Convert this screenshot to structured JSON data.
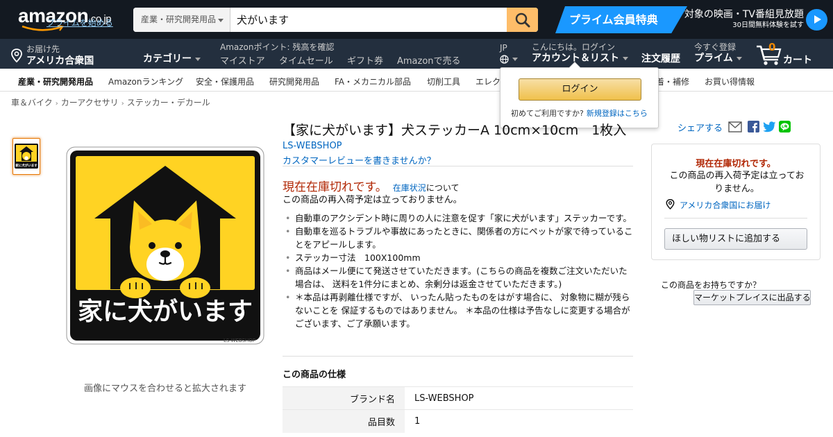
{
  "header": {
    "logo": {
      "word": "amazon",
      "suffix": ".co.jp",
      "prime_link": "プライムを始める"
    },
    "search": {
      "category": "産業・研究開発用品",
      "query": "犬がいます"
    },
    "prime_banner": {
      "badge": "プライム会員特典",
      "line1": "対象の映画・TV番組見放題",
      "line2": "30日間無料体験を試す"
    }
  },
  "nav": {
    "deliver_label": "お届け先",
    "deliver_place": "アメリカ合衆国",
    "category": "カテゴリー",
    "points": "Amazonポイント: 残高を確認",
    "links": [
      "マイストア",
      "タイムセール",
      "ギフト券",
      "Amazonで売る"
    ],
    "lang": "JP",
    "account_greeting": "こんにちは。ログイン",
    "account_label": "アカウント＆リスト",
    "orders": "注文履歴",
    "prime_small": "今すぐ登録",
    "prime_label": "プライム",
    "cart_count": "0",
    "cart_label": "カート"
  },
  "subnav": [
    "産業・研究開発用品",
    "Amazonランキング",
    "安全・保護用品",
    "研究開発用品",
    "FA・メカニカル部品",
    "切削工具",
    "エレク",
    "着・補修",
    "お買い得情報"
  ],
  "flyout": {
    "login": "ログイン",
    "first_time": "初めてご利用ですか?",
    "register": "新規登録はこちら"
  },
  "breadcrumb": [
    "車＆バイク",
    "カーアクセサリ",
    "ステッカー・デカール"
  ],
  "product": {
    "image_text": "家に犬がいます",
    "image_credit": "LS-WEBSHOP",
    "thumb_text": "家に犬がいます",
    "image_caption": "画像にマウスを合わせると拡大されます",
    "title": "【家に犬がいます】犬ステッカーA 10cm×10cm　1枚入",
    "brand": "LS-WEBSHOP",
    "review_link": "カスタマーレビューを書きませんか？",
    "out_of_stock": "現在在庫切れです。",
    "stock_link": "在庫状況",
    "stock_suffix": "について",
    "restock": "この商品の再入荷予定は立っておりません。",
    "bullets": [
      "自動車のアクシデント時に周りの人に注意を促す「家に犬がいます」ステッカーです。",
      "自動車を巡るトラブルや事故にあったときに、関係者の方にペットが家で待っていることをアピールします。",
      "ステッカー寸法　100X100mm",
      "商品はメール便にて発送させていただきます。(こちらの商品を複数ご注文いただいた場合は、 送料を1件分にまとめ、余剰分は返金させていただきます。)",
      "＊本品は再剥離仕様ですが、 いったん貼ったものをはがす場合に、 対象物に糊が残らないことを 保証するものではありません。 ＊本品の仕様は予告なしに変更する場合がございます、ご了承願います。"
    ],
    "spec_title": "この商品の仕様",
    "specs": [
      {
        "key": "ブランド名",
        "value": "LS-WEBSHOP"
      },
      {
        "key": "品目数",
        "value": "1"
      }
    ]
  },
  "right": {
    "share": "シェアする",
    "buybox": {
      "oos": "現在在庫切れです。",
      "msg": "この商品の再入荷予定は立っておりません。",
      "deliver": "アメリカ合衆国にお届け",
      "wishlist": "ほしい物リストに追加する"
    },
    "sell_q": "この商品をお持ちですか？",
    "sell_btn": "マーケットプレイスに出品する"
  },
  "colors": {
    "nav_bg": "#131921",
    "nav2_bg": "#232f3e",
    "search_btn": "#febd69",
    "prime_blue": "#1a98ff",
    "price_red": "#b12704",
    "link": "#0066c0",
    "sticker_yellow": "#ffd323"
  }
}
